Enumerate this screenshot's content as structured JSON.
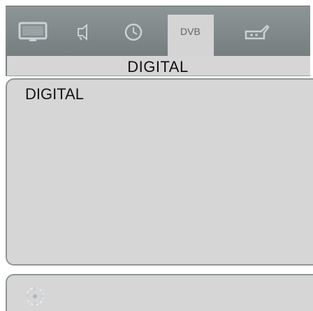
{
  "menu": {
    "tabs": [
      {
        "icon": "tv-picture-icon",
        "active": false
      },
      {
        "icon": "audio-icon",
        "active": false
      },
      {
        "icon": "clock-icon",
        "active": false
      },
      {
        "icon": "dvb-icon",
        "label": "DVB",
        "active": true
      },
      {
        "icon": "usb-source-icon",
        "active": false
      }
    ],
    "title": "DIGITAL"
  },
  "content": {
    "heading": "DIGITAL"
  },
  "footer": {
    "icon": "navigation-joystick-icon"
  },
  "colors": {
    "tabbar": "#848b8c",
    "panel": "#d6d6d6",
    "border": "#8f9596",
    "icon": "#c9d2d4"
  }
}
